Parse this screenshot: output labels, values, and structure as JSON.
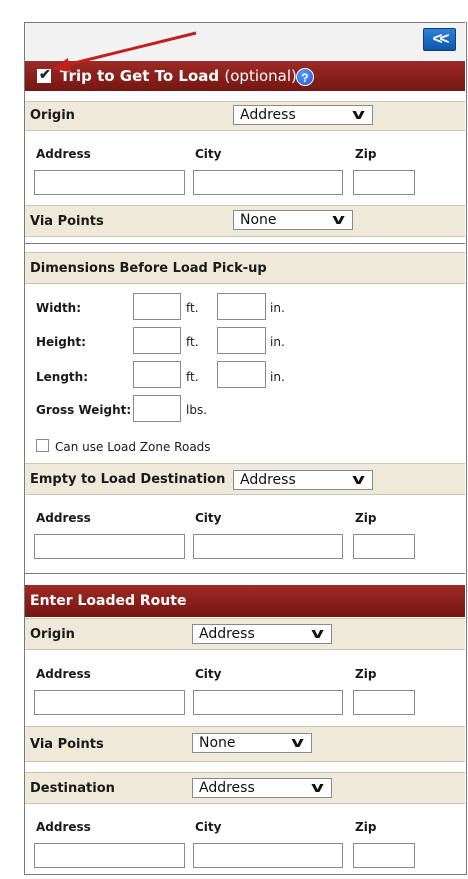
{
  "panel": {
    "collapse_label": "<<"
  },
  "trip": {
    "checkbox_checked": true,
    "title": "Trip to Get To Load",
    "optional": "(optional)",
    "help_icon": "question-mark-icon",
    "origin": {
      "label": "Origin",
      "select": "Address",
      "addr": "Address",
      "city": "City",
      "zip": "Zip"
    },
    "via": {
      "label": "Via Points",
      "select": "None"
    },
    "dims_title": "Dimensions Before Load Pick-up",
    "width": "Width:",
    "height": "Height:",
    "length": "Length:",
    "ft": "ft.",
    "in": "in.",
    "gross": "Gross Weight:",
    "lbs": "lbs.",
    "loadzone": "Can use Load Zone Roads",
    "dest": {
      "label": "Empty to Load Destination",
      "select": "Address",
      "addr": "Address",
      "city": "City",
      "zip": "Zip"
    }
  },
  "loaded": {
    "title": "Enter Loaded Route",
    "origin": {
      "label": "Origin",
      "select": "Address",
      "addr": "Address",
      "city": "City",
      "zip": "Zip"
    },
    "via": {
      "label": "Via Points",
      "select": "None"
    },
    "dest": {
      "label": "Destination",
      "select": "Address",
      "addr": "Address",
      "city": "City",
      "zip": "Zip"
    }
  },
  "colors": {
    "header_red": "#8b1f1b",
    "section_tan": "#efe9d9",
    "annotation_arrow": "#c0201e"
  }
}
